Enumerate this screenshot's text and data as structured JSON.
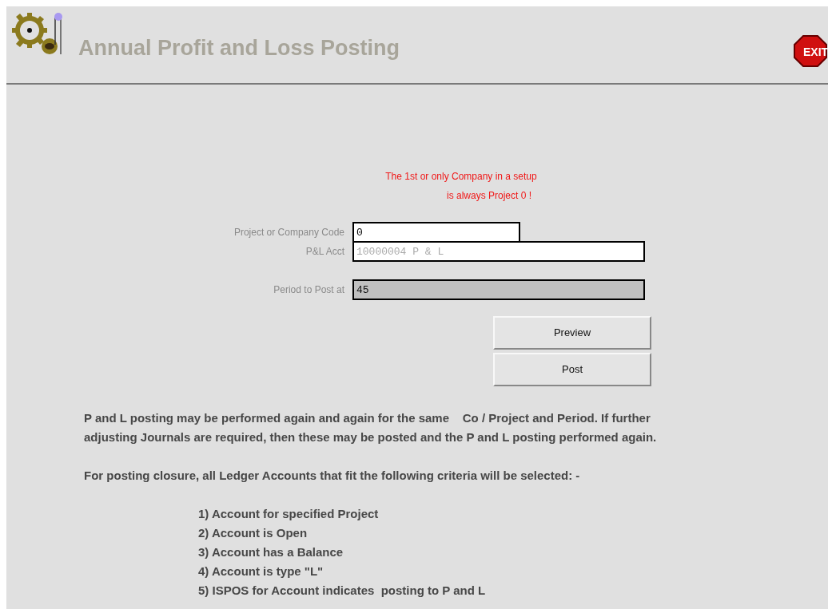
{
  "header": {
    "title": "Annual Profit and Loss Posting",
    "exit_label": "EXIT"
  },
  "notice": [
    "The 1st or only Company in a setup",
    "is always Project 0 !"
  ],
  "fields": [
    {
      "label": "Project or Company Code",
      "value": "0",
      "kind": "input"
    },
    {
      "label": "P&L Acct",
      "value": "10000004 P & L",
      "kind": "display"
    },
    {
      "label": "Period to Post at",
      "value": "45",
      "kind": "locked"
    }
  ],
  "buttons": [
    "Preview",
    "Post"
  ],
  "info": "P and L posting may be performed again and again for the same    Co / Project and Period. If further\nadjusting Journals are required, then these may be posted and the P and L posting performed again.",
  "criteria_intro": "For posting closure, all Ledger Accounts that fit the following criteria will be selected: -",
  "criteria": [
    "1) Account for specified Project",
    "2) Account is Open",
    "3) Account has a Balance",
    "4) Account is type \"L\"",
    "5) ISPOS for Account indicates  posting to P and L"
  ]
}
